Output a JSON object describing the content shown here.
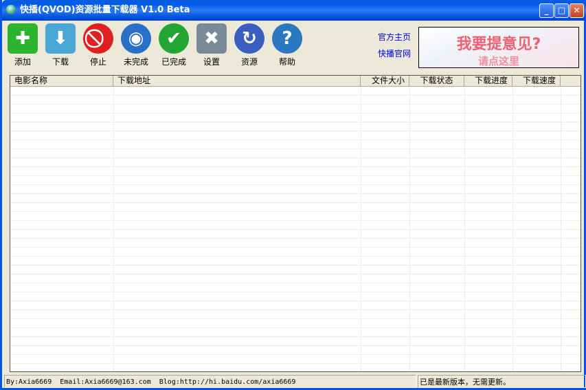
{
  "window": {
    "title": "快播(QVOD)资源批量下载器 V1.0 Beta",
    "minimize": "_",
    "maximize": "□",
    "close": "✕"
  },
  "toolbar": [
    {
      "label": "添加",
      "icon": "add-icon",
      "color": "#2cb52c"
    },
    {
      "label": "下载",
      "icon": "download-arrow-icon",
      "color": "#4aa6d6"
    },
    {
      "label": "停止",
      "icon": "stop-icon",
      "color": "#e02020"
    },
    {
      "label": "未完成",
      "icon": "globe-download-icon",
      "color": "#2a6fc8"
    },
    {
      "label": "已完成",
      "icon": "check-icon",
      "color": "#22a532"
    },
    {
      "label": "设置",
      "icon": "tools-icon",
      "color": "#7a8a98"
    },
    {
      "label": "资源",
      "icon": "refresh-globe-icon",
      "color": "#3a5ec0"
    },
    {
      "label": "帮助",
      "icon": "help-icon",
      "color": "#2a78c0"
    }
  ],
  "links": {
    "home": "官方主页",
    "qvod": "快播官网"
  },
  "banner": {
    "line1": "我要提意见?",
    "line2": "请点这里"
  },
  "table": {
    "columns": [
      "电影名称",
      "下载地址",
      "文件大小",
      "下载状态",
      "下载进度",
      "下载速度"
    ],
    "rows": []
  },
  "status": {
    "info": "By:Axia6669  Email:Axia6669@163.com  Blog:http://hi.baidu.com/axia6669",
    "message": "已是最新版本，无需更新。"
  }
}
